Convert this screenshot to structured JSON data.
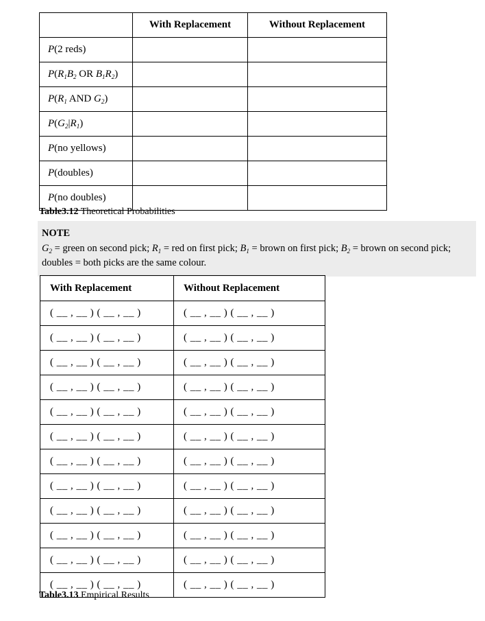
{
  "theoretical_table": {
    "caption_number": "Table3.12",
    "caption_text": " Theoretical Probabilities",
    "headers": {
      "blank": "",
      "with_replacement": "With Replacement",
      "without_replacement": "Without Replacement"
    },
    "rows": [
      {
        "label_plain": "P(2 reds)",
        "with": "",
        "without": ""
      },
      {
        "label_plain": "P(R1B2 OR B1R2)",
        "with": "",
        "without": ""
      },
      {
        "label_plain": "P(R1 AND G2)",
        "with": "",
        "without": ""
      },
      {
        "label_plain": "P(G2|R1)",
        "with": "",
        "without": ""
      },
      {
        "label_plain": "P(no yellows)",
        "with": "",
        "without": ""
      },
      {
        "label_plain": "P(doubles)",
        "with": "",
        "without": ""
      },
      {
        "label_plain": "P(no doubles)",
        "with": "",
        "without": ""
      }
    ]
  },
  "note": {
    "title": "NOTE",
    "body_plain": "G2 = green on second pick; R1 = red on first pick; B1 = brown on first pick; B2 = brown on second pick; doubles = both picks are the same colour.",
    "background_color": "#ececec"
  },
  "empirical_table": {
    "caption_number": "Table3.13",
    "caption_text": " Empirical Results",
    "headers": {
      "with_replacement": "With Replacement",
      "without_replacement": "Without Replacement"
    },
    "cell_template": "( __ , __ ) ( __ , __ )",
    "row_count": 12,
    "rows": [
      {
        "with": "( __ , __ ) ( __ , __ )",
        "without": "( __ , __ ) ( __ , __ )"
      },
      {
        "with": "( __ , __ ) ( __ , __ )",
        "without": "( __ , __ ) ( __ , __ )"
      },
      {
        "with": "( __ , __ ) ( __ , __ )",
        "without": "( __ , __ ) ( __ , __ )"
      },
      {
        "with": "( __ , __ ) ( __ , __ )",
        "without": "( __ , __ ) ( __ , __ )"
      },
      {
        "with": "( __ , __ ) ( __ , __ )",
        "without": "( __ , __ ) ( __ , __ )"
      },
      {
        "with": "( __ , __ ) ( __ , __ )",
        "without": "( __ , __ ) ( __ , __ )"
      },
      {
        "with": "( __ , __ ) ( __ , __ )",
        "without": "( __ , __ ) ( __ , __ )"
      },
      {
        "with": "( __ , __ ) ( __ , __ )",
        "without": "( __ , __ ) ( __ , __ )"
      },
      {
        "with": "( __ , __ ) ( __ , __ )",
        "without": "( __ , __ ) ( __ , __ )"
      },
      {
        "with": "( __ , __ ) ( __ , __ )",
        "without": "( __ , __ ) ( __ , __ )"
      },
      {
        "with": "( __ , __ ) ( __ , __ )",
        "without": "( __ , __ ) ( __ , __ )"
      },
      {
        "with": "( __ , __ ) ( __ , __ )",
        "without": "( __ , __ ) ( __ , __ )"
      }
    ]
  }
}
